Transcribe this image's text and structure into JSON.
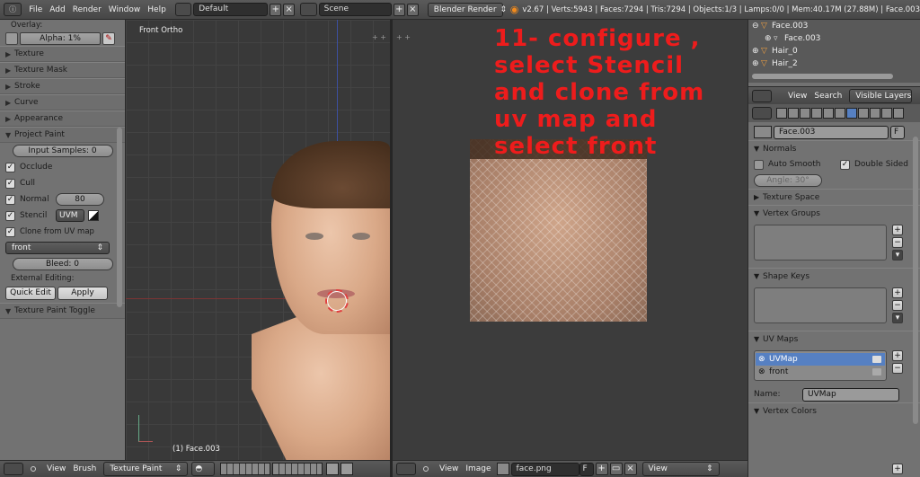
{
  "topbar": {
    "menus": [
      "File",
      "Add",
      "Render",
      "Window",
      "Help"
    ],
    "screen_layout": "Default",
    "scene": "Scene",
    "render_engine": "Blender Render",
    "stats": "v2.67 | Verts:5943 | Faces:7294 | Tris:7294 | Objects:1/3 | Lamps:0/0 | Mem:40.17M (27.88M) | Face.003"
  },
  "tool_panel": {
    "overlay_label": "Overlay:",
    "alpha_field": "Alpha: 1%",
    "sections": [
      "Texture",
      "Texture Mask",
      "Stroke",
      "Curve",
      "Appearance"
    ],
    "project_paint_title": "Project Paint",
    "input_samples": "Input Samples: 0",
    "occlude": "Occlude",
    "cull": "Cull",
    "normal_label": "Normal",
    "normal_value": "80",
    "stencil_label": "Stencil",
    "stencil_uv": "UVM",
    "clone_label": "Clone from UV map",
    "clone_uv": "front",
    "bleed": "Bleed: 0",
    "external_label": "External Editing:",
    "quick_edit": "Quick Edit",
    "apply": "Apply",
    "toggle_title": "Texture Paint Toggle"
  },
  "viewport_3d": {
    "view_name": "Front Ortho",
    "object_label": "(1) Face.003",
    "menus": [
      "View",
      "Brush"
    ],
    "mode": "Texture Paint"
  },
  "image_editor": {
    "menus": [
      "View",
      "Image"
    ],
    "image_name": "face.png",
    "image_f": "F",
    "view_mode": "View"
  },
  "annotation": "11- configure ,\nselect Stencil\nand clone from\nuv map and\nselect front",
  "outliner": {
    "items": [
      "Face.003",
      "Face.003",
      "Hair_0",
      "Hair_2"
    ],
    "menus": [
      "View",
      "Search"
    ],
    "filter": "Visible Layers"
  },
  "properties": {
    "mesh_name": "Face.003",
    "mesh_f": "F",
    "normals_title": "Normals",
    "auto_smooth": "Auto Smooth",
    "double_sided": "Double Sided",
    "angle": "Angle: 30°",
    "texture_space": "Texture Space",
    "vertex_groups": "Vertex Groups",
    "shape_keys": "Shape Keys",
    "uv_maps": "UV Maps",
    "uv_items": [
      "UVMap",
      "front"
    ],
    "name_label": "Name:",
    "name_value": "UVMap",
    "vertex_colors": "Vertex Colors"
  },
  "colors": {
    "annotation": "#ee1c1c",
    "selection": "#5680c2",
    "panel": "#727272",
    "viewport": "#393939"
  }
}
